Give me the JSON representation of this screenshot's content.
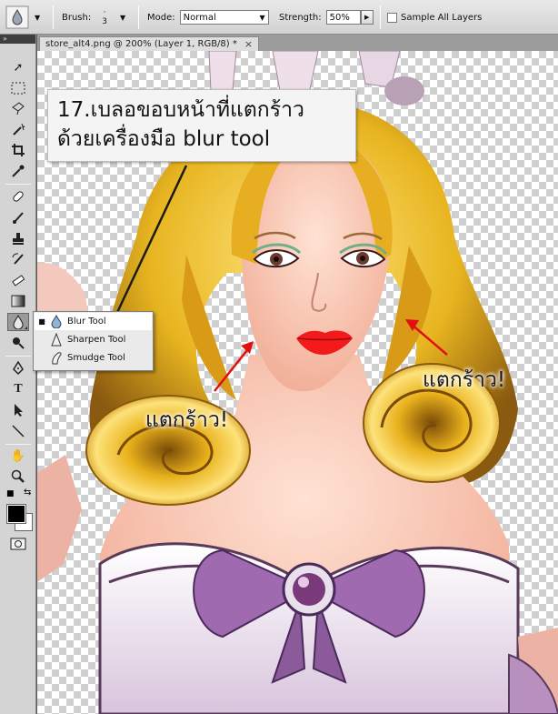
{
  "options_bar": {
    "brush_label": "Brush:",
    "brush_size": "3",
    "mode_label": "Mode:",
    "mode_value": "Normal",
    "strength_label": "Strength:",
    "strength_value": "50%",
    "sample_all_layers": "Sample All Layers"
  },
  "document_tab": {
    "title": "store_alt4.png @ 200% (Layer 1, RGB/8) *",
    "close_glyph": "×"
  },
  "toolbox": {
    "header": "»"
  },
  "annotation": {
    "line1": "17.เบลอขอบหน้าที่แตกร้าว",
    "line2": "ด้วยเครื่องมือ blur tool",
    "crack_left": "แตกร้าว!",
    "crack_right": "แตกร้าว!",
    "arrow_color": "#1a1a1a",
    "crack_arrow_color": "#e01010"
  },
  "flyout_menu": {
    "items": [
      {
        "label": "Blur Tool",
        "selected": true
      },
      {
        "label": "Sharpen Tool",
        "selected": false
      },
      {
        "label": "Smudge Tool",
        "selected": false
      }
    ]
  }
}
